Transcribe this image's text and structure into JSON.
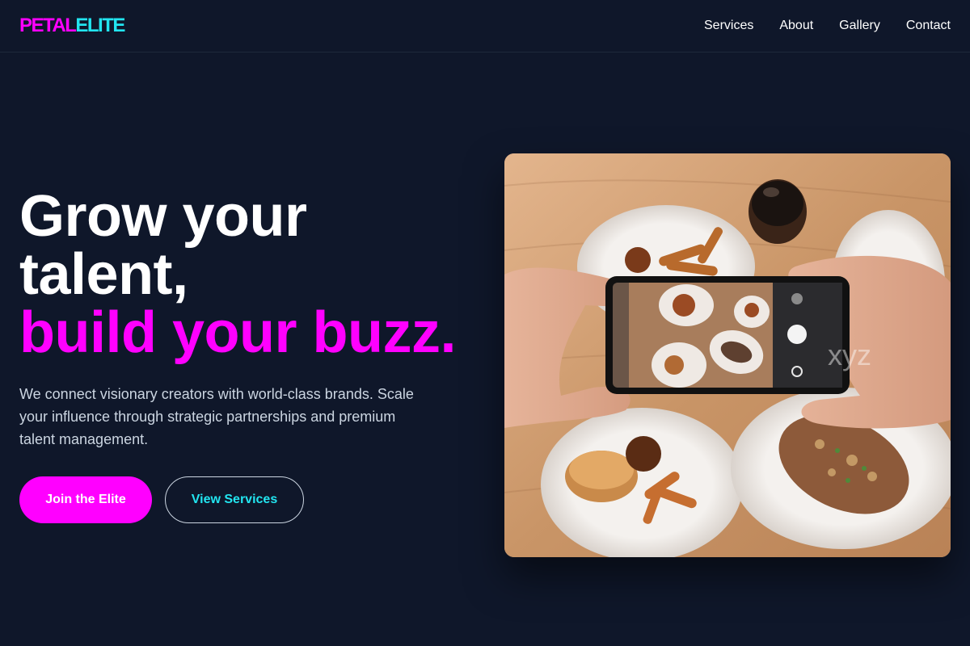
{
  "header": {
    "logo": {
      "part1": "PETAL",
      "part2": "ELITE"
    },
    "nav": [
      {
        "label": "Services"
      },
      {
        "label": "About"
      },
      {
        "label": "Gallery"
      },
      {
        "label": "Contact"
      }
    ]
  },
  "hero": {
    "headline_line1": "Grow your talent,",
    "headline_line2": "build your buzz.",
    "lead": "We connect visionary creators with world-class brands. Scale your influence through strategic partnerships and premium talent management.",
    "primary_cta": "Join the Elite",
    "secondary_cta": "View Services",
    "image": {
      "icon": "photo-food-phone",
      "watermark": "xyz"
    }
  },
  "colors": {
    "background": "#0f172a",
    "accent_magenta": "#ff00ff",
    "accent_cyan": "#22e5f0",
    "body_text": "#cbd5e1"
  }
}
